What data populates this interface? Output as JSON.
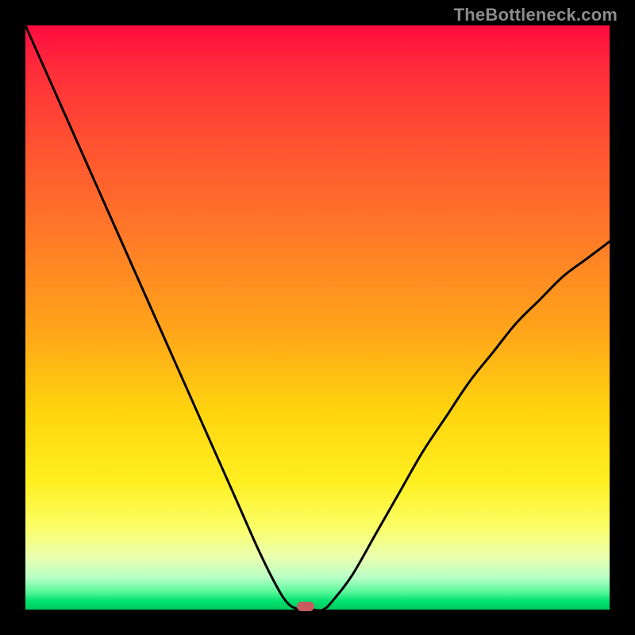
{
  "watermark": {
    "text": "TheBottleneck.com"
  },
  "chart_data": {
    "type": "line",
    "title": "",
    "xlabel": "",
    "ylabel": "",
    "xlim": [
      0,
      100
    ],
    "ylim": [
      0,
      100
    ],
    "grid": false,
    "legend": false,
    "background_gradient": {
      "direction": "vertical",
      "stops": [
        {
          "pos": 0,
          "color": "#ff0b3f"
        },
        {
          "pos": 0.5,
          "color": "#ffb015"
        },
        {
          "pos": 0.82,
          "color": "#fff040"
        },
        {
          "pos": 0.96,
          "color": "#8cffb0"
        },
        {
          "pos": 1.0,
          "color": "#00c95e"
        }
      ]
    },
    "series": [
      {
        "name": "bottleneck-curve",
        "color": "#000000",
        "x": [
          0,
          4,
          8,
          12,
          16,
          20,
          24,
          28,
          32,
          36,
          40,
          43,
          45,
          47,
          49,
          51,
          53,
          56,
          60,
          64,
          68,
          72,
          76,
          80,
          84,
          88,
          92,
          96,
          100
        ],
        "y": [
          100,
          91,
          82,
          73,
          64,
          55,
          46,
          37,
          28,
          19,
          10,
          4,
          1,
          0,
          0,
          0,
          2,
          6,
          13,
          20,
          27,
          33,
          39,
          44,
          49,
          53,
          57,
          60,
          63
        ]
      }
    ],
    "marker": {
      "x": 48,
      "y": 0.6,
      "color": "#c95b5e",
      "shape": "pill"
    }
  }
}
